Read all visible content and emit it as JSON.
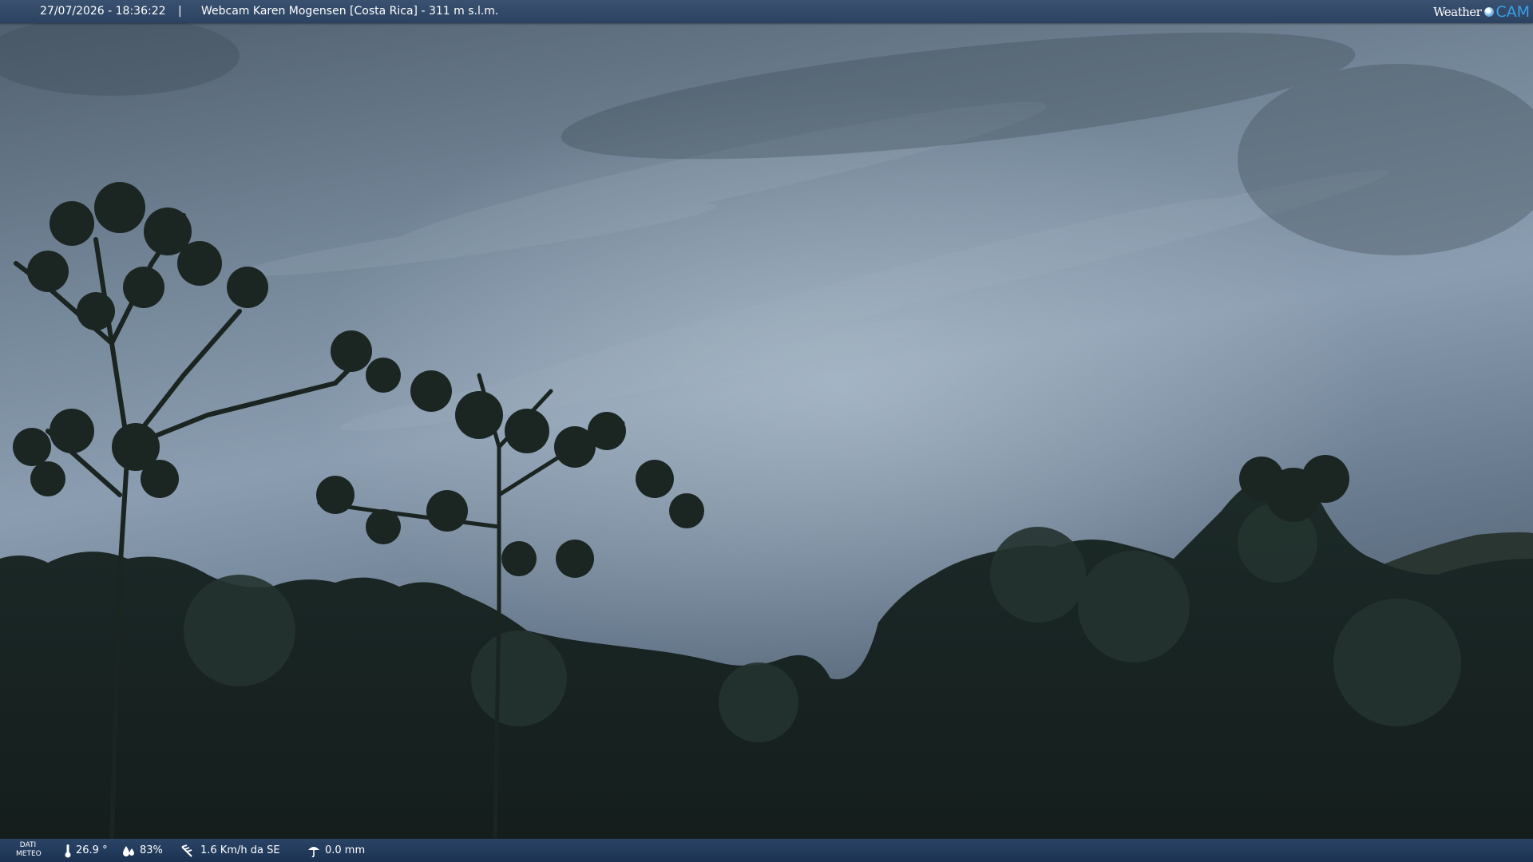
{
  "header": {
    "datetime": "27/07/2026 - 18:36:22",
    "separator": "|",
    "title": "Webcam Karen Mogensen [Costa Rica] - 311 m s.l.m."
  },
  "logo": {
    "part1": "Weather",
    "part2": "CAM"
  },
  "weather_panel": {
    "label_line1": "DATI",
    "label_line2": "METEO",
    "temperature": "26.9 °",
    "humidity": "83%",
    "wind": "1.6 Km/h da SE",
    "rain": "0.0 mm"
  },
  "icons": [
    "thermometer-icon",
    "humidity-drops-icon",
    "wind-icon",
    "rain-umbrella-icon"
  ],
  "colors": {
    "bar_top": "#2f4666",
    "bar_bottom": "#1c3252",
    "logo_accent": "#3aa0e8"
  }
}
